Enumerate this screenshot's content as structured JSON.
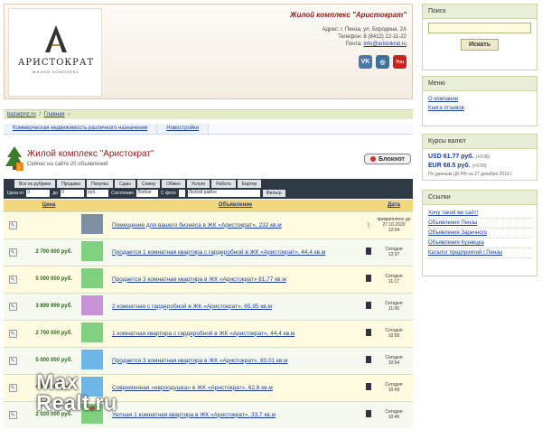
{
  "header": {
    "logo_text": "АРИСТОКРАТ",
    "logo_sub": "ЖИЛОЙ КОМПЛЕКС",
    "company_title": "Жилой комплекс \"Аристократ\"",
    "address": "Адрес: г. Пенза, ул. Бородина, 2А",
    "phone": "Телефон: 8 (8412) 22-11-22",
    "email_label": "Почта:",
    "email": "info@aristokrat.ru",
    "socials": [
      {
        "name": "vk",
        "label": "VK",
        "color": "#4a76a8"
      },
      {
        "name": "instagram",
        "label": "◎",
        "color": "#3f729b"
      },
      {
        "name": "youtube",
        "label": "You",
        "color": "#cd201f"
      }
    ]
  },
  "search": {
    "title": "Поиск",
    "placeholder": "",
    "button": "Искать"
  },
  "menu": {
    "title": "Меню",
    "items": [
      "О компании",
      "Книга отзывов"
    ]
  },
  "rates": {
    "title": "Курсы валют",
    "usd_label": "USD",
    "usd_value": "61.77 руб.",
    "usd_change": "(+0.06)",
    "eur_label": "EUR",
    "eur_value": "68.5 руб.",
    "eur_change": "(+0.09)",
    "note": "По данным ЦБ РФ на 27 декабря 2019 г."
  },
  "links": {
    "title": "Ссылки",
    "items": [
      "Хочу такой же сайт!",
      "Объявления Пензы",
      "Объявления Заречного",
      "Объявления Кузнецка",
      "Каталог предприятий г.Пензы"
    ]
  },
  "breadcrumb": {
    "site": "bazarpnz.ru",
    "sep": "/",
    "home": "Главная",
    "arrow": "›"
  },
  "topnav": [
    "Коммерческая недвижимость различного назначения",
    "Новостройки"
  ],
  "listing": {
    "title": "Жилой комплекс \"Аристократ\"",
    "subtitle": "Сейчас на сайте 20 объявлений",
    "notepad": "Блокнот"
  },
  "tabs": [
    "Все из рубрики",
    "Продажа",
    "Покупка",
    "Сдаю",
    "Сниму",
    "Обмен",
    "Услуги",
    "Работа",
    "Бартер"
  ],
  "filters": {
    "price_from": "Цена от",
    "from_val": "0",
    "to_label": "до",
    "to_val": "0",
    "currency": "руб.",
    "state_label": "Состояние",
    "state_val": "Любое",
    "photo_label": "С фото",
    "district_val": "Любой район",
    "apply": "Фильтр"
  },
  "table": {
    "col_price": "Цена",
    "col_title": "Объявление",
    "col_date": "Дата",
    "rows": [
      {
        "price": "",
        "title": "Помещение для вашего бизнеса в ЖК «Аристократ», 232 кв.м",
        "date1": "прикреплено до 27.10.2020",
        "date2": "12:04",
        "thumb": "#7c8fa3"
      },
      {
        "price": "2 700 000 руб.",
        "title": "Продается 1 комнатная квартира с гардеробной в ЖК «Аристократ», 44,4 кв.м",
        "date1": "Сегодня",
        "date2": "12:37",
        "thumb": "#7fd07f"
      },
      {
        "price": "5 000 000 руб.",
        "title": "Продается 3 комнатная квартира в ЖК «Аристократ» 81,77 кв.м",
        "date1": "Сегодня",
        "date2": "11:17",
        "thumb": "#7fd07f"
      },
      {
        "price": "3 899 999 руб.",
        "title": "2 комнатная с гардеробной в ЖК «Аристократ», 65,95 кв.м",
        "date1": "Сегодня",
        "date2": "11:06",
        "thumb": "#c792d6"
      },
      {
        "price": "2 700 000 руб.",
        "title": "1 комнатная квартира с гардеробной в ЖК «Аристократ», 44,4 кв.м",
        "date1": "Сегодня",
        "date2": "10:58",
        "thumb": "#7fd07f"
      },
      {
        "price": "5 000 000 руб.",
        "title": "Продается 3 комнатная квартира в ЖК «Аристократ», 83,01 кв.м",
        "date1": "Сегодня",
        "date2": "10:54",
        "thumb": "#6fb6e8"
      },
      {
        "price": "4 000 000 руб.",
        "title": "Современная «евроодушка» в ЖК «Аристократ», 62,8 кв.м",
        "date1": "Сегодня",
        "date2": "10:49",
        "thumb": "#6fb6e8"
      },
      {
        "price": "2 020 000 руб.",
        "title": "Уютная 1 комнатная квартира в ЖК «Аристократ», 33,7 кв.м",
        "date1": "Сегодня",
        "date2": "10:46",
        "thumb": "#7fd07f"
      }
    ]
  },
  "watermark": {
    "line1": "Max",
    "line2a": "Realt",
    "dot": ".",
    "line2b": "ru"
  }
}
